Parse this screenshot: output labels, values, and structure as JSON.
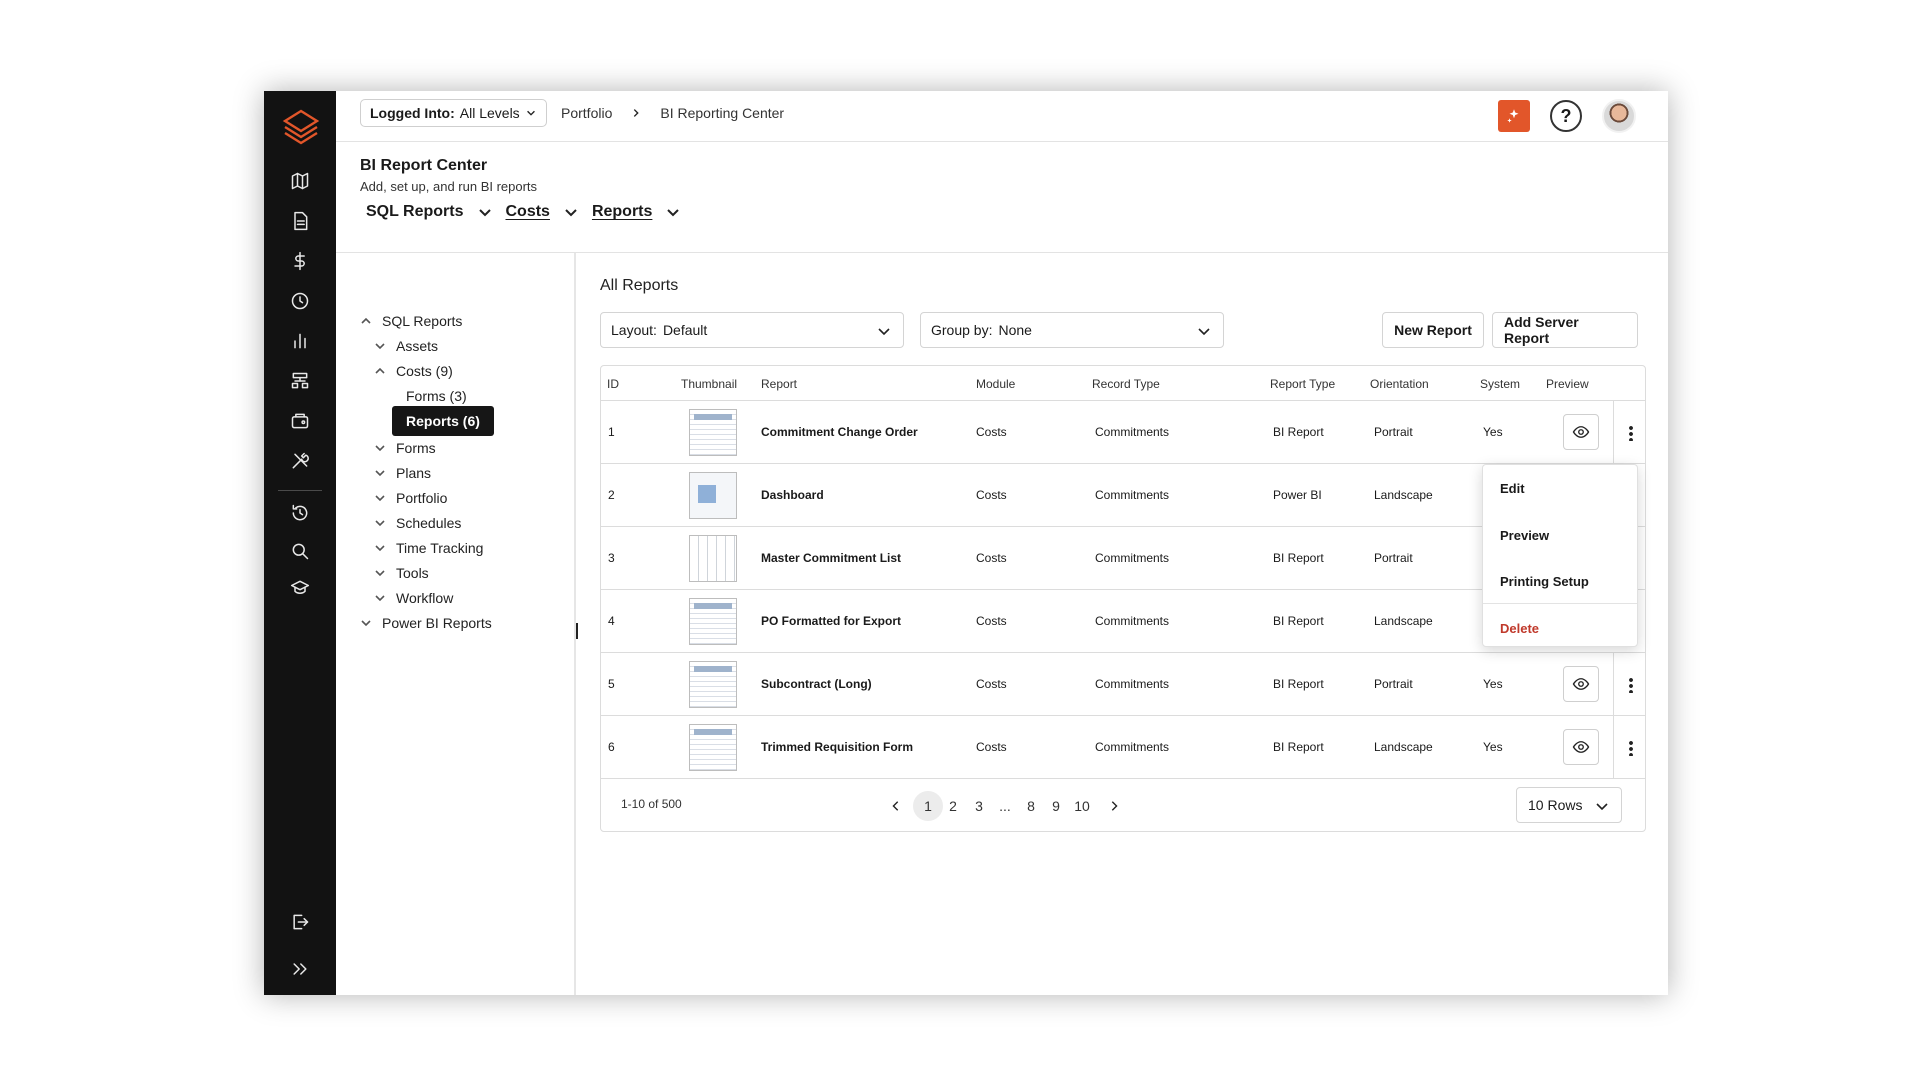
{
  "topbar": {
    "login_key": "Logged Into:",
    "login_value": "All Levels",
    "breadcrumb": [
      "Portfolio",
      "BI Reporting Center"
    ]
  },
  "header": {
    "title": "BI Report Center",
    "subtitle": "Add, set up, and run BI reports",
    "tabs": [
      "SQL Reports",
      "Costs",
      "Reports"
    ]
  },
  "tree": {
    "items": [
      {
        "label": "SQL Reports"
      },
      {
        "label": "Assets"
      },
      {
        "label": "Costs (9)"
      },
      {
        "label": "Forms (3)"
      },
      {
        "label": "Reports (6)"
      },
      {
        "label": "Forms"
      },
      {
        "label": "Plans"
      },
      {
        "label": "Portfolio"
      },
      {
        "label": "Schedules"
      },
      {
        "label": "Time Tracking"
      },
      {
        "label": "Tools"
      },
      {
        "label": "Workflow"
      },
      {
        "label": "Power BI Reports"
      }
    ]
  },
  "main": {
    "title": "All Reports",
    "layout_key": "Layout:",
    "layout_value": "Default",
    "group_key": "Group by:",
    "group_value": "None",
    "new_report": "New Report",
    "add_server_report": "Add Server Report"
  },
  "table": {
    "columns": [
      "ID",
      "Thumbnail",
      "Report",
      "Module",
      "Record Type",
      "Report Type",
      "Orientation",
      "System",
      "Preview"
    ],
    "rows": [
      {
        "id": "1",
        "report": "Commitment Change Order",
        "module": "Costs",
        "record_type": "Commitments",
        "report_type": "BI Report",
        "orientation": "Portrait",
        "system": "Yes"
      },
      {
        "id": "2",
        "report": "Dashboard",
        "module": "Costs",
        "record_type": "Commitments",
        "report_type": "Power BI",
        "orientation": "Landscape",
        "system": ""
      },
      {
        "id": "3",
        "report": "Master Commitment List",
        "module": "Costs",
        "record_type": "Commitments",
        "report_type": "BI Report",
        "orientation": "Portrait",
        "system": ""
      },
      {
        "id": "4",
        "report": "PO Formatted for Export",
        "module": "Costs",
        "record_type": "Commitments",
        "report_type": "BI Report",
        "orientation": "Landscape",
        "system": ""
      },
      {
        "id": "5",
        "report": "Subcontract (Long)",
        "module": "Costs",
        "record_type": "Commitments",
        "report_type": "BI Report",
        "orientation": "Portrait",
        "system": "Yes"
      },
      {
        "id": "6",
        "report": "Trimmed Requisition Form",
        "module": "Costs",
        "record_type": "Commitments",
        "report_type": "BI Report",
        "orientation": "Landscape",
        "system": "Yes"
      }
    ]
  },
  "pagination": {
    "count": "1-10 of 500",
    "pages": [
      "1",
      "2",
      "3",
      "...",
      "8",
      "9",
      "10"
    ],
    "current": "1",
    "rows_per_page": "10 Rows"
  },
  "context_menu": {
    "items": [
      "Edit",
      "Preview",
      "Printing Setup",
      "Delete"
    ]
  },
  "colors": {
    "rail": "#121212",
    "accent": "#e2562a",
    "danger": "#c0392b"
  },
  "icons": [
    "logo-icon",
    "map-icon",
    "document-icon",
    "dollar-icon",
    "clock-icon",
    "bar-chart-icon",
    "org-chart-icon",
    "wallet-icon",
    "tools-icon",
    "history-icon",
    "search-icon",
    "graduation-cap-icon",
    "logout-icon",
    "expand-icon",
    "ai-icon",
    "help-icon",
    "eye-icon",
    "kebab-icon"
  ]
}
